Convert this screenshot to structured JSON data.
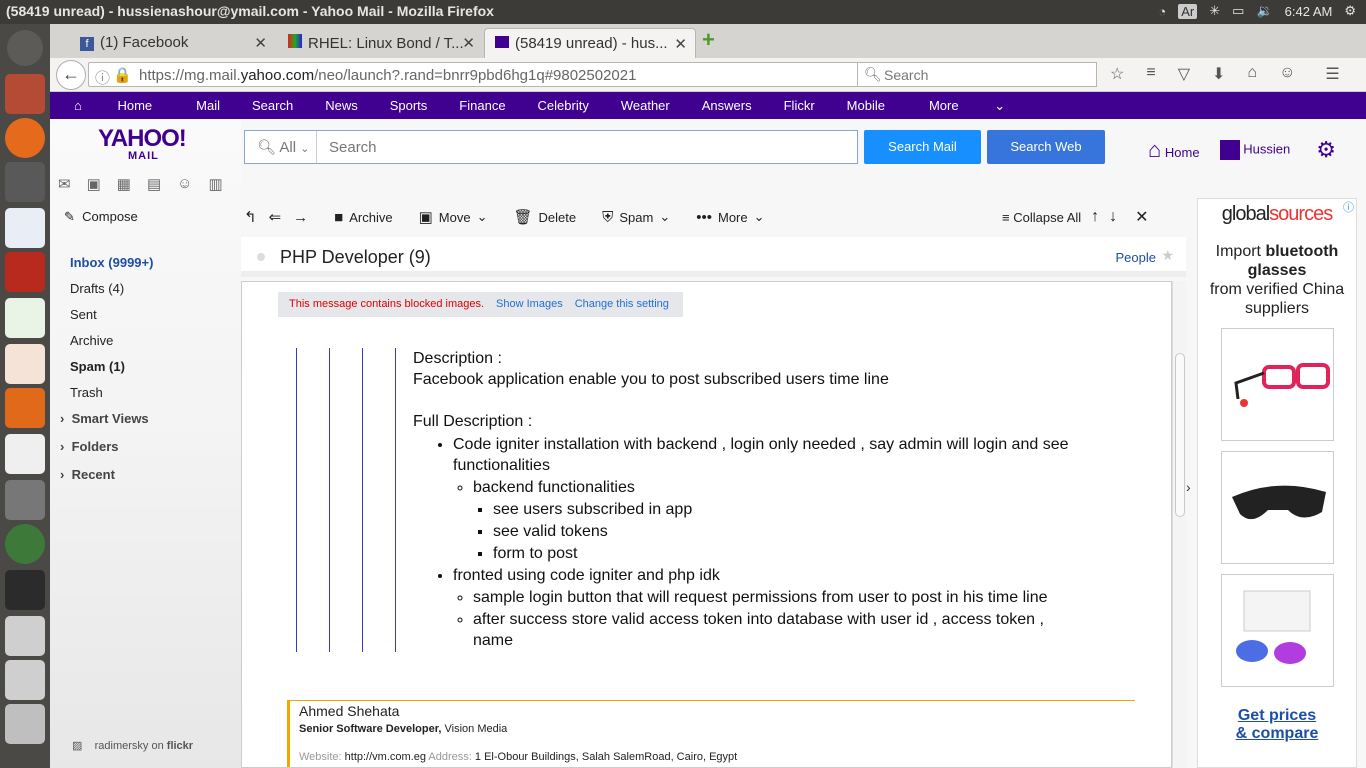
{
  "os": {
    "window_title": "(58419 unread) - hussienashour@ymail.com - Yahoo Mail - Mozilla Firefox",
    "tray_input": "Ar",
    "clock": "6:42 AM"
  },
  "browser": {
    "tabs": [
      {
        "label": "(1) Facebook"
      },
      {
        "label": "RHEL: Linux Bond / T..."
      },
      {
        "label": "(58419 unread) - hus..."
      }
    ],
    "url_prefix": "https://mg.mail.",
    "url_domain": "yahoo.com",
    "url_rest": "/neo/launch?.rand=bnrr9pbd6hg1q#9802502021",
    "search_placeholder": "Search"
  },
  "yahoo_nav": [
    "Home",
    "Mail",
    "Search",
    "News",
    "Sports",
    "Finance",
    "Celebrity",
    "Weather",
    "Answers",
    "Flickr",
    "Mobile",
    "More"
  ],
  "header": {
    "logo_top": "YAHOO!",
    "logo_bottom": "MAIL",
    "search_scope": "All",
    "search_placeholder": "Search",
    "search_mail_label": "Search Mail",
    "search_web_label": "Search Web",
    "home_label": "Home",
    "user_label": "Hussien"
  },
  "sidebar": {
    "compose_label": "Compose",
    "folders": [
      {
        "label": "Inbox (9999+)"
      },
      {
        "label": "Drafts (4)"
      },
      {
        "label": "Sent"
      },
      {
        "label": "Archive"
      },
      {
        "label": "Spam (1)"
      },
      {
        "label": "Trash"
      }
    ],
    "groups": [
      {
        "label": "Smart Views"
      },
      {
        "label": "Folders"
      },
      {
        "label": "Recent"
      }
    ],
    "photo_credit": "radimersky on ",
    "photo_source": "flickr"
  },
  "toolbar": {
    "archive": "Archive",
    "move": "Move",
    "delete": "Delete",
    "spam": "Spam",
    "more": "More",
    "collapse_all": "Collapse All"
  },
  "message": {
    "subject": "PHP Developer (9)",
    "people_label": "People",
    "blocked_notice": "This message contains blocked images.",
    "show_images": "Show Images",
    "change_setting": "Change this setting",
    "desc_heading": "Description :",
    "desc_text": "Facebook application enable you to post subscribed users time line",
    "full_heading": "Full Description :",
    "bullet1": "Code igniter installation with backend , login only needed , say admin will login and see functionalities",
    "sub1": "backend functionalities",
    "sub1_items": [
      "see users subscribed in app",
      "see valid tokens",
      "form to post"
    ],
    "bullet2": "fronted using code igniter and php idk",
    "sub2_items": [
      "sample login button that will request permissions from user to post in his time line",
      "after success store valid access token into database with user id , access token , name"
    ],
    "sig_name": "Ahmed Shehata",
    "sig_role": "Senior Software Developer,",
    "sig_company": "Vision Media",
    "sig_website_label": "Website:",
    "sig_website": "http://vm.com.eg",
    "sig_address_label": "Address:",
    "sig_address": "1 El-Obour Buildings, Salah SalemRoad, Cairo, Egypt"
  },
  "ad": {
    "brand_a": "global",
    "brand_b": "sources",
    "line1": "Import ",
    "line1_bold": "bluetooth glasses",
    "line2": "from verified China suppliers",
    "cta1": "Get prices",
    "cta2": "& compare"
  },
  "colors": {
    "yahoo_purple": "#400090",
    "search_mail_blue": "#188fff",
    "search_web_blue": "#3775dd",
    "ubuntu_panel": "#3c3b37"
  }
}
